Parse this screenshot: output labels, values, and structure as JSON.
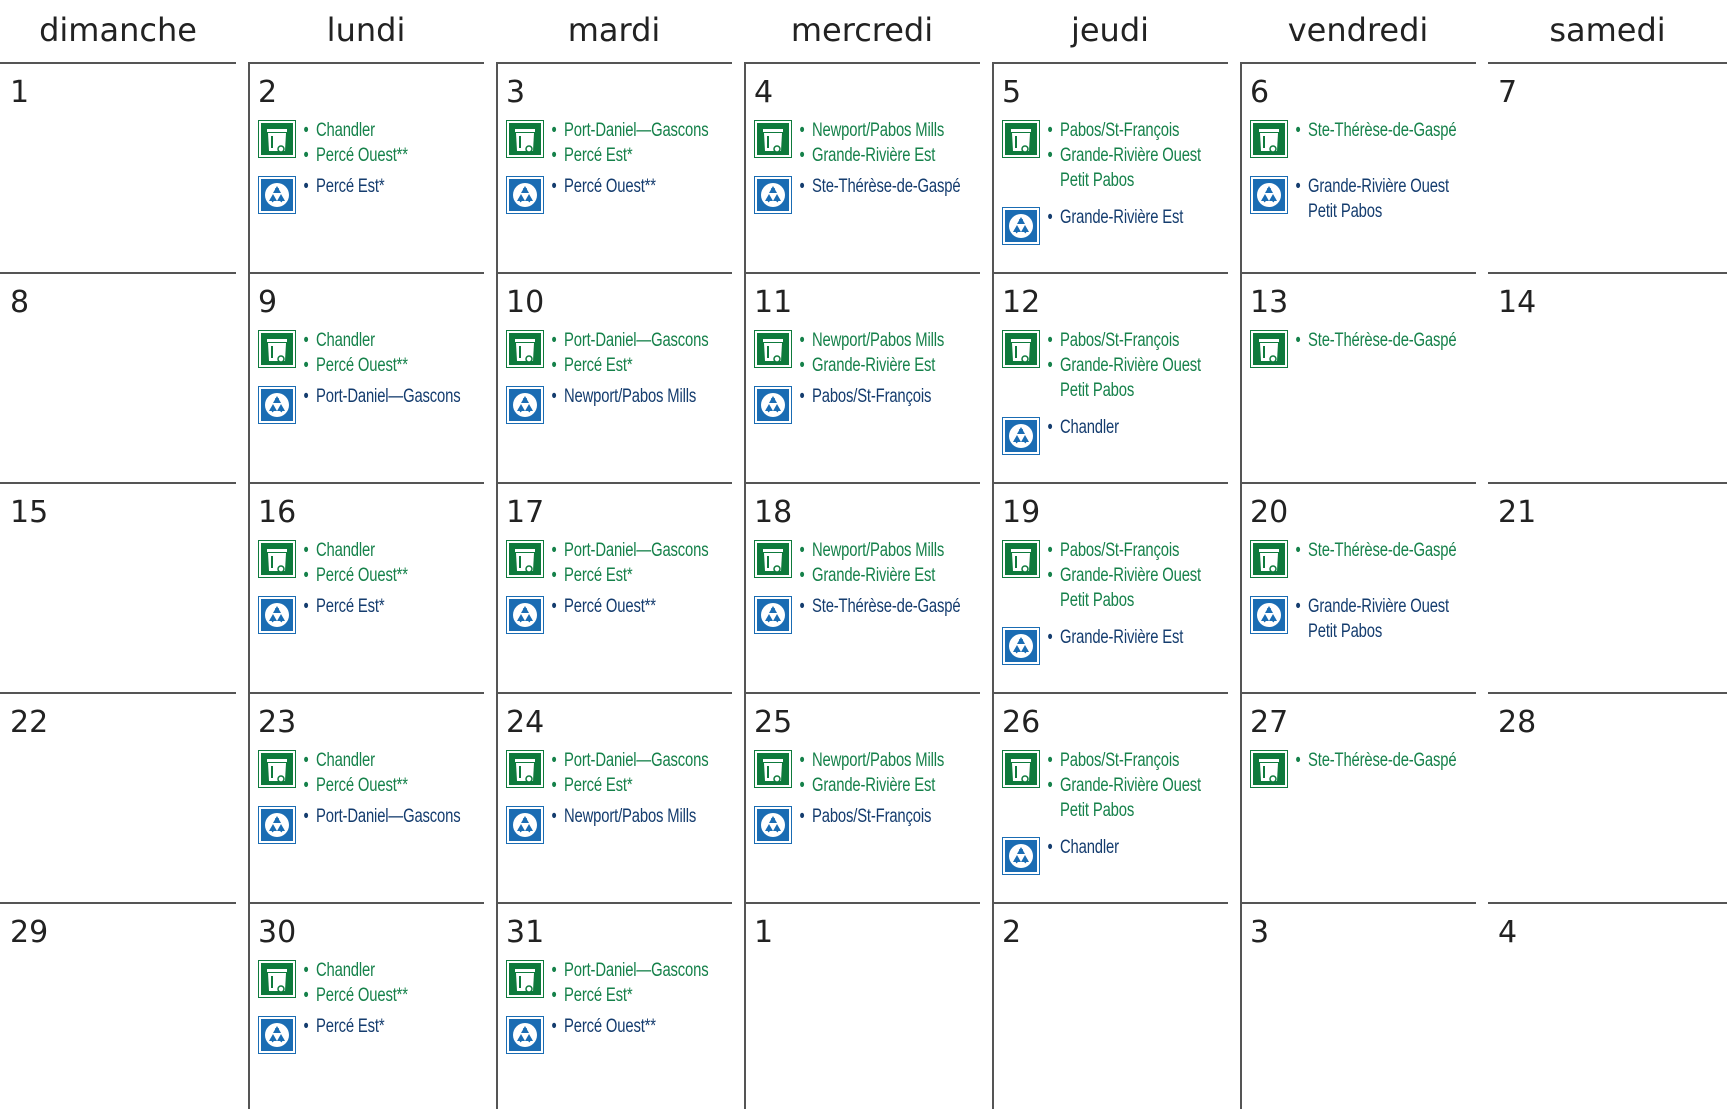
{
  "weekdays": [
    "dimanche",
    "lundi",
    "mardi",
    "mercredi",
    "jeudi",
    "vendredi",
    "samedi"
  ],
  "icons": {
    "garbage": "garbage-bin-icon",
    "recycling": "recycling-icon"
  },
  "colors": {
    "garbage": "#15814a",
    "recycling": "#143c6e",
    "garbage_icon_bg": "#0e7a3c",
    "recycling_icon_bg": "#1a6cb3"
  },
  "weeks": [
    [
      {
        "day": "1"
      },
      {
        "day": "2",
        "garbage": [
          "Chandler",
          "Percé Ouest**"
        ],
        "recycling": [
          "Percé Est*"
        ]
      },
      {
        "day": "3",
        "garbage": [
          "Port-Daniel—Gascons",
          "Percé Est*"
        ],
        "recycling": [
          "Percé Ouest**"
        ]
      },
      {
        "day": "4",
        "garbage": [
          "Newport/Pabos Mills",
          "Grande-Rivière Est"
        ],
        "recycling": [
          "Ste-Thérèse-de-Gaspé"
        ]
      },
      {
        "day": "5",
        "garbage": [
          "Pabos/St-François",
          "Grande-Rivière Ouest|Petit Pabos"
        ],
        "recycling": [
          "Grande-Rivière Est"
        ]
      },
      {
        "day": "6",
        "garbage": [
          "Ste-Thérèse-de-Gaspé"
        ],
        "recycling": [
          "Grande-Rivière Ouest|Petit Pabos"
        ]
      },
      {
        "day": "7"
      }
    ],
    [
      {
        "day": "8"
      },
      {
        "day": "9",
        "garbage": [
          "Chandler",
          "Percé Ouest**"
        ],
        "recycling": [
          "Port-Daniel—Gascons"
        ]
      },
      {
        "day": "10",
        "garbage": [
          "Port-Daniel—Gascons",
          "Percé Est*"
        ],
        "recycling": [
          "Newport/Pabos Mills"
        ]
      },
      {
        "day": "11",
        "garbage": [
          "Newport/Pabos Mills",
          "Grande-Rivière Est"
        ],
        "recycling": [
          "Pabos/St-François"
        ]
      },
      {
        "day": "12",
        "garbage": [
          "Pabos/St-François",
          "Grande-Rivière Ouest|Petit Pabos"
        ],
        "recycling": [
          "Chandler"
        ]
      },
      {
        "day": "13",
        "garbage": [
          "Ste-Thérèse-de-Gaspé"
        ]
      },
      {
        "day": "14"
      }
    ],
    [
      {
        "day": "15"
      },
      {
        "day": "16",
        "garbage": [
          "Chandler",
          "Percé Ouest**"
        ],
        "recycling": [
          "Percé Est*"
        ]
      },
      {
        "day": "17",
        "garbage": [
          "Port-Daniel—Gascons",
          "Percé Est*"
        ],
        "recycling": [
          "Percé Ouest**"
        ]
      },
      {
        "day": "18",
        "garbage": [
          "Newport/Pabos Mills",
          "Grande-Rivière Est"
        ],
        "recycling": [
          "Ste-Thérèse-de-Gaspé"
        ]
      },
      {
        "day": "19",
        "garbage": [
          "Pabos/St-François",
          "Grande-Rivière Ouest|Petit Pabos"
        ],
        "recycling": [
          "Grande-Rivière Est"
        ]
      },
      {
        "day": "20",
        "garbage": [
          "Ste-Thérèse-de-Gaspé"
        ],
        "recycling": [
          "Grande-Rivière Ouest|Petit Pabos"
        ]
      },
      {
        "day": "21"
      }
    ],
    [
      {
        "day": "22"
      },
      {
        "day": "23",
        "garbage": [
          "Chandler",
          "Percé Ouest**"
        ],
        "recycling": [
          "Port-Daniel—Gascons"
        ]
      },
      {
        "day": "24",
        "garbage": [
          "Port-Daniel—Gascons",
          "Percé Est*"
        ],
        "recycling": [
          "Newport/Pabos Mills"
        ]
      },
      {
        "day": "25",
        "garbage": [
          "Newport/Pabos Mills",
          "Grande-Rivière Est"
        ],
        "recycling": [
          "Pabos/St-François"
        ]
      },
      {
        "day": "26",
        "garbage": [
          "Pabos/St-François",
          "Grande-Rivière Ouest|Petit Pabos"
        ],
        "recycling": [
          "Chandler"
        ]
      },
      {
        "day": "27",
        "garbage": [
          "Ste-Thérèse-de-Gaspé"
        ]
      },
      {
        "day": "28"
      }
    ],
    [
      {
        "day": "29"
      },
      {
        "day": "30",
        "garbage": [
          "Chandler",
          "Percé Ouest**"
        ],
        "recycling": [
          "Percé Est*"
        ]
      },
      {
        "day": "31",
        "garbage": [
          "Port-Daniel—Gascons",
          "Percé Est*"
        ],
        "recycling": [
          "Percé Ouest**"
        ]
      },
      {
        "day": "1"
      },
      {
        "day": "2"
      },
      {
        "day": "3"
      },
      {
        "day": "4"
      }
    ]
  ]
}
